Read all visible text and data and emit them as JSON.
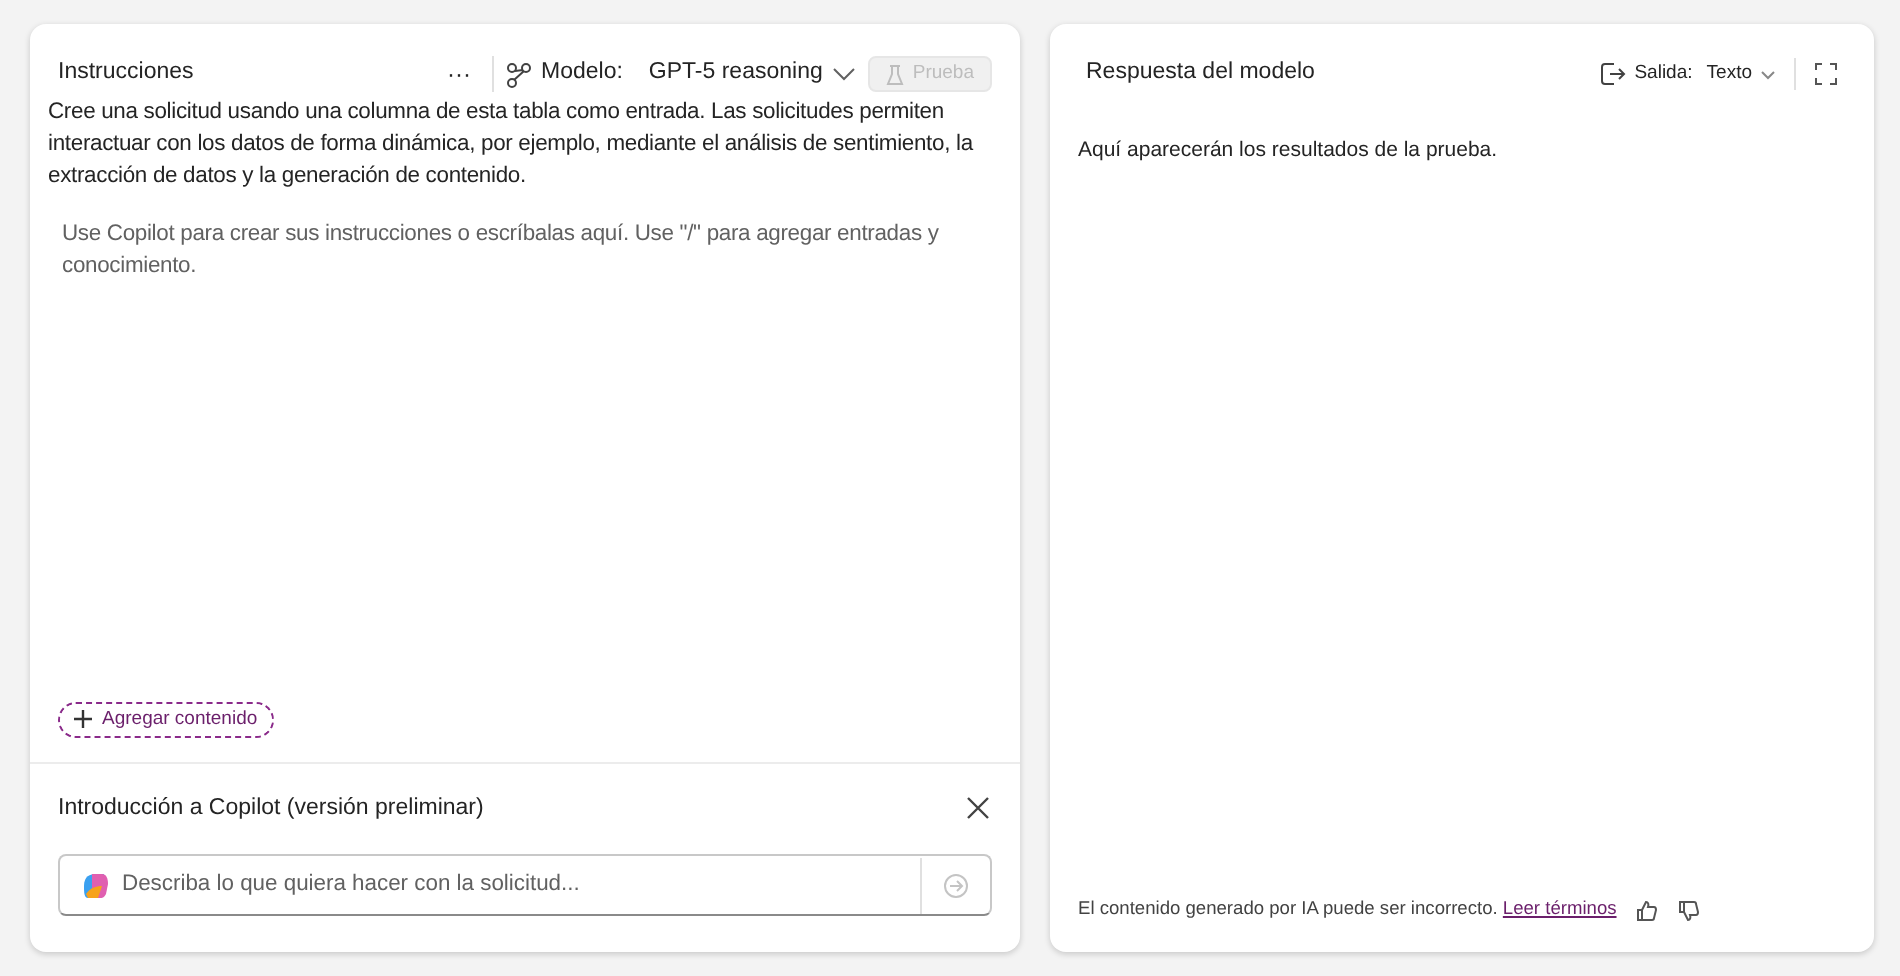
{
  "instructions": {
    "title": "Instrucciones",
    "more": "···",
    "model_label": "Modelo:",
    "model_value": "GPT-5 reasoning",
    "test_button": {
      "label": "Prueba",
      "disabled": true
    },
    "description": "Cree una solicitud usando una columna de esta tabla como entrada. Las solicitudes permiten interactuar con los datos de forma dinámica, por ejemplo, mediante el análisis de sentimiento, la extracción de datos y la generación de contenido.",
    "placeholder": "Use Copilot para crear sus instrucciones o escríbalas aquí. Use \"/\" para agregar entradas y conocimiento.",
    "add_button": "Agregar contenido"
  },
  "copilot": {
    "title": "Introducción a Copilot (versión preliminar)",
    "input": {
      "placeholder": "Describa lo que quiera hacer con la solicitud..."
    }
  },
  "response": {
    "title": "Respuesta del modelo",
    "output_label": "Salida:",
    "output_value": "Texto",
    "body": "Aquí aparecerán los resultados de la prueba.",
    "disclaimer": "El contenido generado por IA puede ser incorrecto.",
    "terms_link": "Leer términos"
  }
}
